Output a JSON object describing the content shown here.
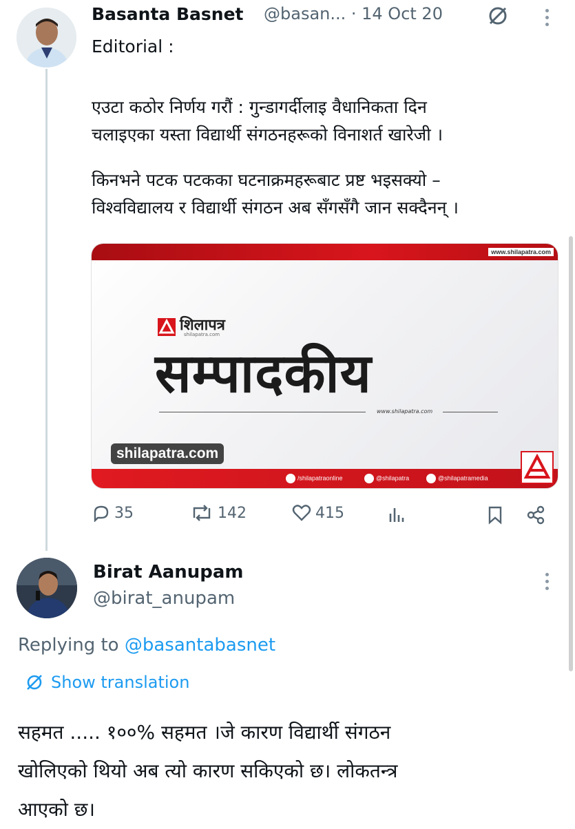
{
  "tweet": {
    "author_name": "Basanta Basnet",
    "handle_date": "@basan... · 14 Oct 20",
    "body_lines": [
      "Editorial :",
      "",
      "एउटा कठोर निर्णय गरौं : गुन्डागर्दीलाइ वैधानिकता दिन",
      "चलाइएका यस्ता  विद्यार्थी संगठनहरूको विनाशर्त खारेजी ।",
      "",
      "किनभने पटक पटकका घटनाक्रमहरूबाट प्रष्ट भइसक्यो –",
      "विश्वविद्यालय र विद्यार्थी संगठन अब सँगसँगै जान सक्दैनन् ।"
    ],
    "card": {
      "url_top": "www.shilapatra.com",
      "brand": "शिलापत्र",
      "brand_sub": "shilapatra.com",
      "headline": "सम्पादकीय",
      "web": "www.shilapatra.com",
      "badge": "shilapatra.com",
      "social": [
        "/shilapatraonline",
        "@shilapatra",
        "@shilapatramedia"
      ]
    },
    "actions": {
      "replies": "35",
      "reposts": "142",
      "likes": "415"
    }
  },
  "reply": {
    "author_name": "Birat Aanupam",
    "handle": "@birat_anupam",
    "replying_prefix": "Replying to ",
    "replying_to": "@basantabasnet",
    "show_translation": "Show translation",
    "body_lines": [
      "सहमत ..... १००% सहमत  ।जे कारण विद्यार्थी संगठन",
      "खोलिएको थियो अब त्यो कारण सकिएको छ। लोकतन्त्र",
      "आएको छ।"
    ]
  },
  "icons": [
    "avatar",
    "grok-icon",
    "more-icon",
    "reply-icon",
    "repost-icon",
    "like-icon",
    "views-icon",
    "bookmark-icon",
    "share-icon",
    "translate-icon"
  ],
  "colors": {
    "accent": "#1d9bf0",
    "muted": "#536471",
    "brand_red": "#d8151c"
  }
}
